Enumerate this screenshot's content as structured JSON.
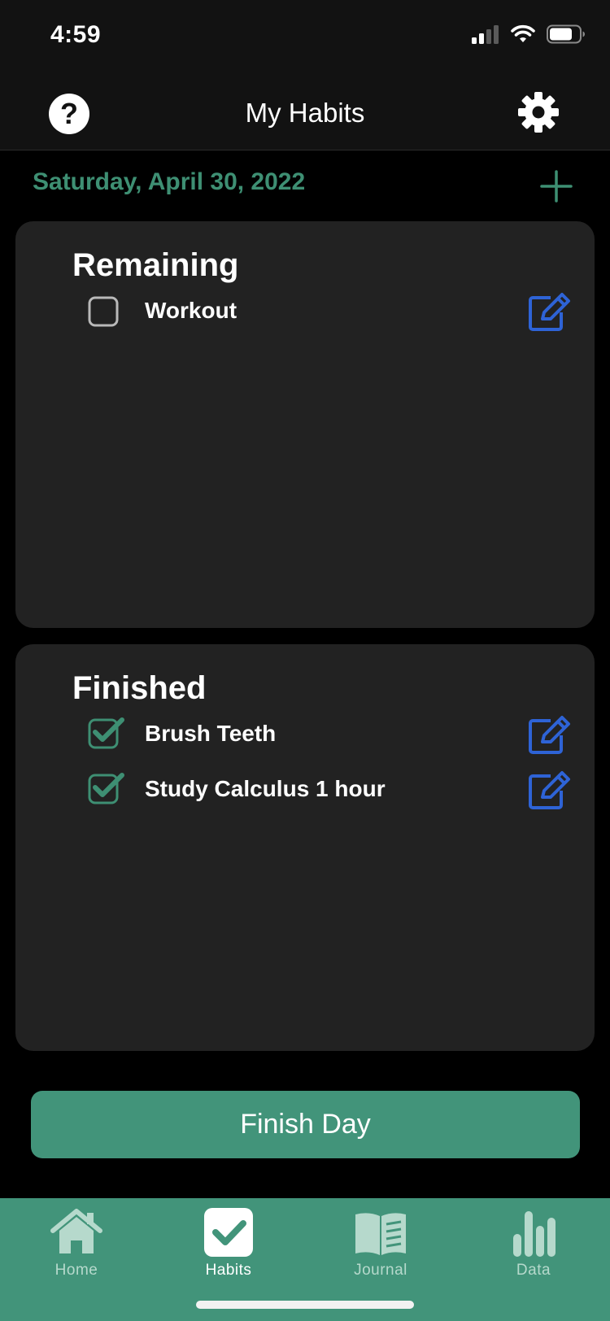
{
  "status": {
    "time": "4:59"
  },
  "header": {
    "title": "My Habits"
  },
  "date_label": "Saturday, April 30, 2022",
  "remaining": {
    "title": "Remaining",
    "items": [
      {
        "label": "Workout",
        "done": false
      }
    ]
  },
  "finished": {
    "title": "Finished",
    "items": [
      {
        "label": "Brush Teeth",
        "done": true
      },
      {
        "label": "Study Calculus 1 hour",
        "done": true
      }
    ]
  },
  "finish_button": "Finish Day",
  "tabs": [
    {
      "label": "Home",
      "icon": "home-icon",
      "active": false
    },
    {
      "label": "Habits",
      "icon": "checkmark-icon",
      "active": true
    },
    {
      "label": "Journal",
      "icon": "book-icon",
      "active": false
    },
    {
      "label": "Data",
      "icon": "bar-chart-icon",
      "active": false
    }
  ],
  "colors": {
    "accent": "#42947a",
    "date_text": "#3e8f73",
    "edit_icon": "#2e63d6",
    "card_bg": "#222222",
    "check": "#3e8f73"
  }
}
